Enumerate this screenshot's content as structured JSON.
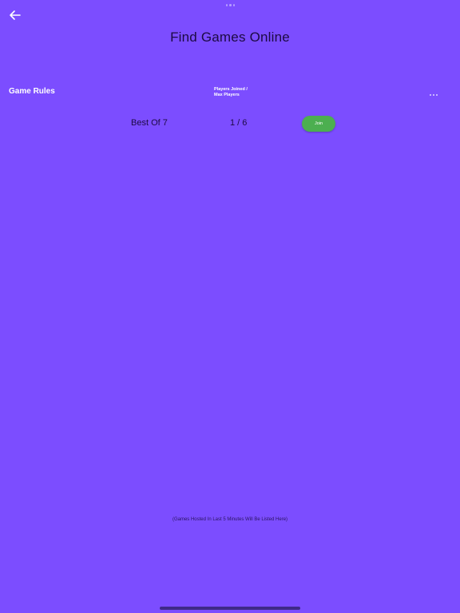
{
  "header": {
    "title": "Find Games Online",
    "back_icon": "arrow-left-icon"
  },
  "table": {
    "columns": {
      "rules": "Game Rules",
      "players_line1": "Players Joined /",
      "players_line2": "Max Players",
      "more_icon": "more-horizontal-icon"
    },
    "rows": [
      {
        "rules": "Best Of 7",
        "players": "1 / 6",
        "action_label": "Join"
      }
    ]
  },
  "footer": {
    "note": "(Games Hosted In Last 5 Minutes Will Be Listed Here)"
  },
  "colors": {
    "background": "#7c4dff",
    "join_button": "#4caf50",
    "title_text": "#1c0a42"
  }
}
